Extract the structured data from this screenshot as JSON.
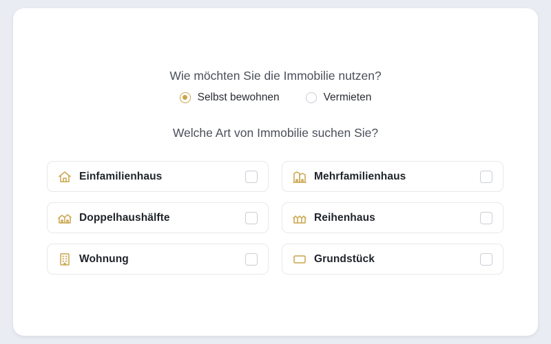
{
  "usage": {
    "question": "Wie möchten Sie die Immobilie nutzen?",
    "options": [
      {
        "label": "Selbst bewohnen",
        "selected": true
      },
      {
        "label": "Vermieten",
        "selected": false
      }
    ]
  },
  "property": {
    "question": "Welche Art von Immobilie suchen Sie?",
    "types": [
      {
        "label": "Einfamilienhaus",
        "icon": "house-icon",
        "checked": false
      },
      {
        "label": "Mehrfamilienhaus",
        "icon": "apartment-building-icon",
        "checked": false
      },
      {
        "label": "Doppelhaushälfte",
        "icon": "semi-detached-house-icon",
        "checked": false
      },
      {
        "label": "Reihenhaus",
        "icon": "row-house-icon",
        "checked": false
      },
      {
        "label": "Wohnung",
        "icon": "flat-building-icon",
        "checked": false
      },
      {
        "label": "Grundstück",
        "icon": "plot-icon",
        "checked": false
      }
    ]
  },
  "colors": {
    "accent": "#c9a449",
    "background": "#e9edf3",
    "card": "#ffffff",
    "text": "#1f2329"
  }
}
